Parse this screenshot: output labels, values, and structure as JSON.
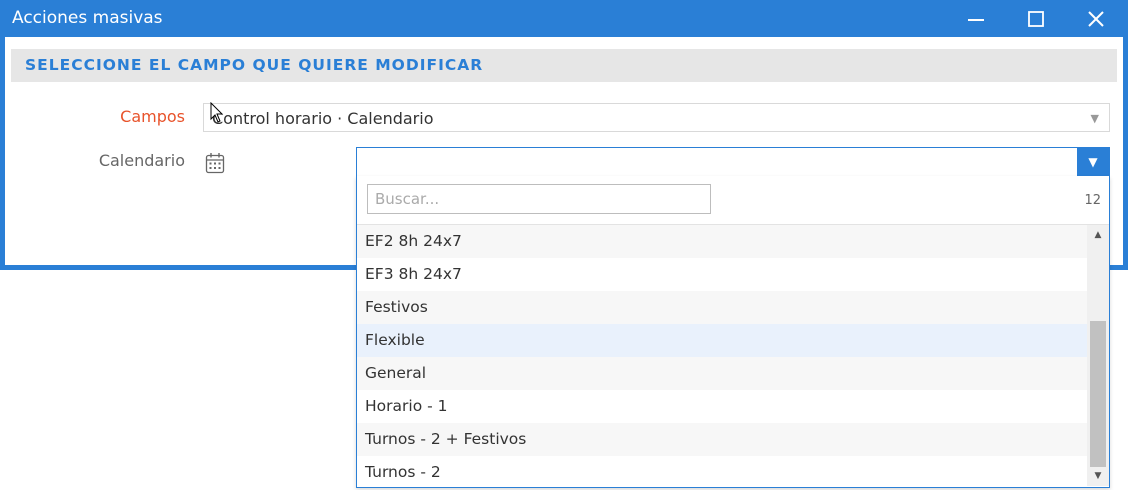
{
  "window": {
    "title": "Acciones masivas",
    "accent_color": "#2a7fd6"
  },
  "section": {
    "header": "SELECCIONE EL CAMPO QUE QUIERE MODIFICAR"
  },
  "form": {
    "campos_label": "Campos",
    "campos_value": "Control horario · Calendario",
    "calendario_label": "Calendario",
    "calendario_value": ""
  },
  "dropdown": {
    "search_placeholder": "Buscar...",
    "search_value": "",
    "count": "12",
    "items": [
      "EF2 8h 24x7",
      "EF3 8h 24x7",
      "Festivos",
      "Flexible",
      "General",
      "Horario - 1",
      "Turnos - 2 + Festivos",
      "Turnos - 2"
    ],
    "highlighted": "Flexible"
  },
  "icons": {
    "minimize": "minimize-icon",
    "maximize": "maximize-icon",
    "close": "close-icon",
    "calendar": "calendar-icon",
    "dropdown_arrow": "chevron-down-icon"
  }
}
